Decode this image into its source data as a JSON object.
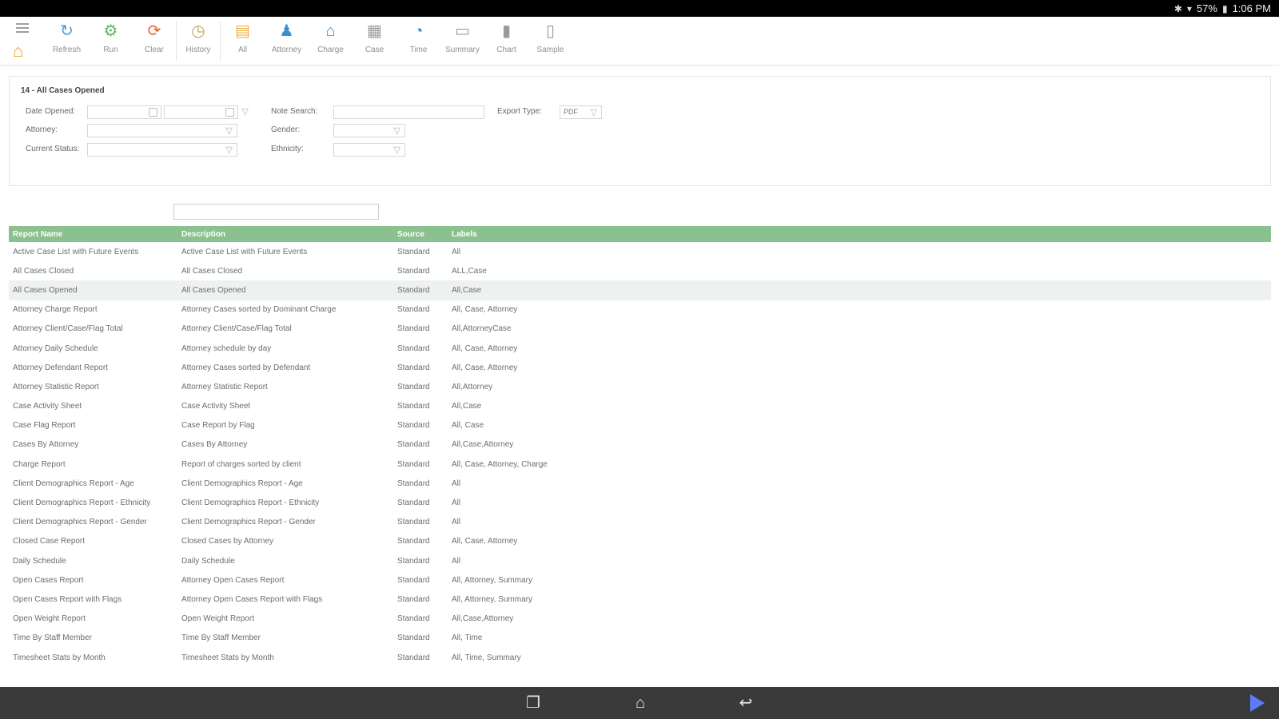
{
  "status_bar": {
    "battery": "57%",
    "time": "1:06 PM"
  },
  "toolbar": {
    "items": [
      {
        "label": "Refresh",
        "icon": "refresh-icon",
        "color": "#4aa0d8"
      },
      {
        "label": "Run",
        "icon": "gear-icon",
        "color": "#5cb85c"
      },
      {
        "label": "Clear",
        "icon": "clear-icon",
        "color": "#e8652b"
      },
      {
        "label": "History",
        "icon": "clock-icon",
        "color": "#c8a34a"
      },
      {
        "label": "All",
        "icon": "document-icon",
        "color": "#f0b040"
      },
      {
        "label": "Attorney",
        "icon": "attorney-icon",
        "color": "#3a8fd0"
      },
      {
        "label": "Charge",
        "icon": "courthouse-icon",
        "color": "#3a8fd0"
      },
      {
        "label": "Case",
        "icon": "case-icon",
        "color": "#9a9a9a"
      },
      {
        "label": "Time",
        "icon": "stopwatch-icon",
        "color": "#3a8fd0"
      },
      {
        "label": "Summary",
        "icon": "summary-icon",
        "color": "#9a9a9a"
      },
      {
        "label": "Chart",
        "icon": "chart-icon",
        "color": "#9a9a9a"
      },
      {
        "label": "Sample",
        "icon": "sample-icon",
        "color": "#9a9a9a"
      }
    ]
  },
  "filters": {
    "title": "14 - All Cases Opened",
    "date_opened_label": "Date Opened:",
    "attorney_label": "Attorney:",
    "current_status_label": "Current Status:",
    "note_search_label": "Note Search:",
    "gender_label": "Gender:",
    "ethnicity_label": "Ethnicity:",
    "export_type_label": "Export Type:",
    "export_type_value": "PDF"
  },
  "table": {
    "headers": [
      "Report Name",
      "Description",
      "Source",
      "Labels"
    ],
    "rows": [
      [
        "Active Case List with Future Events",
        "Active Case List with Future Events",
        "Standard",
        "All"
      ],
      [
        "All Cases Closed",
        "All Cases Closed",
        "Standard",
        "ALL,Case"
      ],
      [
        "All Cases Opened",
        "All Cases Opened",
        "Standard",
        "All,Case"
      ],
      [
        "Attorney Charge Report",
        "Attorney Cases sorted by Dominant Charge",
        "Standard",
        "All, Case, Attorney"
      ],
      [
        "Attorney Client/Case/Flag Total",
        "Attorney Client/Case/Flag Total",
        "Standard",
        "All,AttorneyCase"
      ],
      [
        "Attorney Daily Schedule",
        "Attorney schedule by day",
        "Standard",
        "All, Case, Attorney"
      ],
      [
        "Attorney Defendant Report",
        "Attorney Cases sorted by Defendant",
        "Standard",
        "All, Case, Attorney"
      ],
      [
        "Attorney Statistic Report",
        "Attorney Statistic Report",
        "Standard",
        "All,Attorney"
      ],
      [
        "Case Activity Sheet",
        "Case Activity Sheet",
        "Standard",
        "All,Case"
      ],
      [
        "Case Flag Report",
        "Case Report by Flag",
        "Standard",
        "All, Case"
      ],
      [
        "Cases By Attorney",
        "Cases By Attorney",
        "Standard",
        "All,Case,Attorney"
      ],
      [
        "Charge Report",
        "Report of charges sorted by client",
        "Standard",
        "All, Case, Attorney, Charge"
      ],
      [
        "Client Demographics Report - Age",
        "Client Demographics Report - Age",
        "Standard",
        "All"
      ],
      [
        "Client Demographics Report - Ethnicity",
        "Client Demographics Report - Ethnicity",
        "Standard",
        "All"
      ],
      [
        "Client Demographics Report - Gender",
        "Client Demographics Report - Gender",
        "Standard",
        "All"
      ],
      [
        "Closed Case Report",
        "Closed Cases by Attorney",
        "Standard",
        "All, Case, Attorney"
      ],
      [
        "Daily Schedule",
        "Daily Schedule",
        "Standard",
        "All"
      ],
      [
        "Open Cases Report",
        "Attorney Open Cases Report",
        "Standard",
        "All, Attorney, Summary"
      ],
      [
        "Open Cases Report with Flags",
        "Attorney Open Cases Report with Flags",
        "Standard",
        "All, Attorney, Summary"
      ],
      [
        "Open Weight Report",
        "Open Weight Report",
        "Standard",
        "All,Case,Attorney"
      ],
      [
        "Time By Staff Member",
        "Time By Staff Member",
        "Standard",
        "All, Time"
      ],
      [
        "Timesheet Stats by Month",
        "Timesheet Stats by Month",
        "Standard",
        "All, Time, Summary"
      ]
    ]
  },
  "colors": {
    "header_green": "#8bc08f",
    "selected_row": "#eef2ee"
  }
}
